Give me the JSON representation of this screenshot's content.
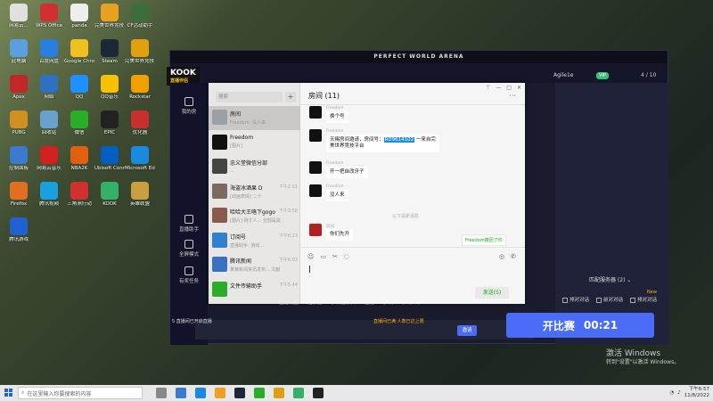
{
  "desktop": {
    "icons": [
      {
        "label": "网易云...",
        "color": "#e0e0e0"
      },
      {
        "label": "WPS Office",
        "color": "#d03030"
      },
      {
        "label": "panda",
        "color": "#eeeeee"
      },
      {
        "label": "完美世界竞技平台",
        "color": "#e8a020"
      },
      {
        "label": "CF活动助手",
        "color": "#3c6e3c"
      },
      {
        "label": "此电脑",
        "color": "#5aa0e0"
      },
      {
        "label": "百度网盘",
        "color": "#2a7ee0"
      },
      {
        "label": "Google Chrome",
        "color": "#f0c020"
      },
      {
        "label": "Steam",
        "color": "#1b2838"
      },
      {
        "label": "完美世界竞技平台",
        "color": "#e0a010"
      },
      {
        "label": "Apex",
        "color": "#c02828"
      },
      {
        "label": "网络",
        "color": "#3070c0"
      },
      {
        "label": "QQ",
        "color": "#1e90ff"
      },
      {
        "label": "QQ音乐",
        "color": "#f7c000"
      },
      {
        "label": "Rockstar",
        "color": "#f0a000"
      },
      {
        "label": "PUBG",
        "color": "#d09020"
      },
      {
        "label": "回收站",
        "color": "#6aa0d0"
      },
      {
        "label": "微信",
        "color": "#2aae2a"
      },
      {
        "label": "EPIC",
        "color": "#222222"
      },
      {
        "label": "优化器",
        "color": "#c83030"
      },
      {
        "label": "控制面板",
        "color": "#3a7ad0"
      },
      {
        "label": "网易云音乐",
        "color": "#d02020"
      },
      {
        "label": "NBA2K",
        "color": "#e06010"
      },
      {
        "label": "Ubisoft Connect",
        "color": "#0060c0"
      },
      {
        "label": "Microsoft Edge",
        "color": "#1a8ae0"
      },
      {
        "label": "Firefox",
        "color": "#e07020"
      },
      {
        "label": "腾讯视频",
        "color": "#18a0e0"
      },
      {
        "label": "三角洲行动",
        "color": "#d03030"
      },
      {
        "label": "KOOK",
        "color": "#35b06a"
      },
      {
        "label": "英雄联盟",
        "color": "#c8a040"
      },
      {
        "label": "腾讯游戏",
        "color": "#2060d0"
      }
    ],
    "watermark_title": "激活 Windows",
    "watermark_sub": "转到\"设置\"以激活 Windows。"
  },
  "taskbar": {
    "search_placeholder": "在这里输入你要搜索的内容",
    "clock_time": "下午6:57",
    "clock_date": "11/8/2022",
    "apps": [
      "#888888",
      "#3a7ad0",
      "#1a8ae0",
      "#f0a020",
      "#1b2838",
      "#2aae2a",
      "#e0a010",
      "#35b06a",
      "#222222"
    ]
  },
  "game": {
    "window_title": "PERFECT WORLD ARENA",
    "logo": "KOOK",
    "logo_sub": "直播伴侣",
    "username": "Agile1e",
    "vip": "VIP",
    "room_count": "4 / 10",
    "sidebar": [
      "我的房",
      "直播助手",
      "全屏模式",
      "有奖任务"
    ],
    "region": "匹配服务器 (2)",
    "options": [
      "排对对话",
      "前对对话",
      "排对对话"
    ],
    "new_badge": "New",
    "start_label": "开比赛",
    "timer": "00:21",
    "quick_label": "邀请",
    "bottom_tabs": [
      "直播设置",
      "播放器",
      "多机位模式",
      "直播",
      "多机",
      "屏幕共享"
    ],
    "tip": "5 直播间已开启直播",
    "tip_warn": "直播间已满 人数已达上限"
  },
  "wechat": {
    "search_placeholder": "搜索",
    "title": "房间 (11)",
    "chats": [
      {
        "name": "房间",
        "preview": "Freedom: 没人来",
        "time": "",
        "color": "#9aa0a8",
        "active": true
      },
      {
        "name": "Freedom",
        "preview": "[图片]",
        "time": "",
        "color": "#111111"
      },
      {
        "name": "忠义堂微信分部",
        "preview": "...",
        "time": "",
        "color": "#444444"
      },
      {
        "name": "海盗冰酒果 D",
        "preview": "[动画表情] 二十",
        "time": "下午2:01",
        "color": "#7a6a60"
      },
      {
        "name": "哈哈大王咯下gogo",
        "preview": "[图片] 刚才人... 全部是黑",
        "time": "下午3:58",
        "color": "#8a5a4a"
      },
      {
        "name": "订阅号",
        "preview": "直播助手: 游戏...",
        "time": "下午6:23",
        "color": "#2f80d0"
      },
      {
        "name": "腾讯新闻",
        "preview": "某某新闻资讯发布... 文献",
        "time": "下午6:03",
        "color": "#3a70c0"
      },
      {
        "name": "文件传输助手",
        "preview": "",
        "time": "下午5:44",
        "color": "#2aae2a"
      }
    ],
    "messages": [
      {
        "sender": "Freedom",
        "text": "换个号"
      },
      {
        "sender": "Freedom",
        "text_before": "天赐房间邀请，房间号：",
        "highlight": "RD9614102",
        "text_after": " 一来自完",
        "line2": "美世界竞技平台"
      },
      {
        "sender": "Freedom",
        "text": "开一把自改牙子"
      },
      {
        "sender": "Freedom",
        "text": "没人来"
      }
    ],
    "system_note": "以下是新消息",
    "my_msg": {
      "sender": "房间",
      "text": "你们先开"
    },
    "freedom_tag": "Freedom撤回了你",
    "send_label": "发送(S)"
  }
}
